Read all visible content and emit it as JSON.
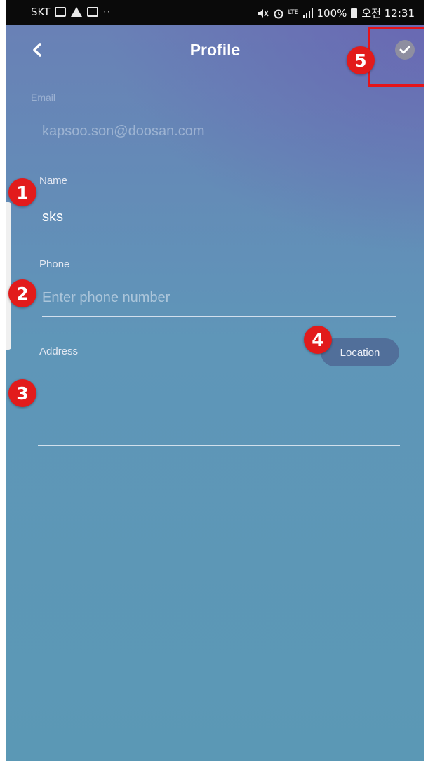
{
  "status_bar": {
    "carrier": "SKT",
    "dots": "··",
    "network": "LTE",
    "battery": "100%",
    "time": "오전 12:31"
  },
  "header": {
    "title": "Profile",
    "back_icon": "chevron-left-icon",
    "save_icon": "check-icon"
  },
  "form": {
    "email": {
      "label": "Email",
      "value": "kapsoo.son@doosan.com"
    },
    "name": {
      "label": "Name",
      "value": "sks"
    },
    "phone": {
      "label": "Phone",
      "value": "",
      "placeholder": "Enter phone number"
    },
    "address": {
      "label": "Address",
      "value": "",
      "location_button": "Location"
    }
  },
  "annotations": {
    "badge_1": "1",
    "badge_2": "2",
    "badge_3": "3",
    "badge_4": "4",
    "badge_5": "5",
    "color": "#e21b1b"
  },
  "colors": {
    "status_bar": "#0a0a0a",
    "background_top": "#6a7fb6",
    "background_bottom": "#5b98b5",
    "highlight": "#e5141a"
  }
}
